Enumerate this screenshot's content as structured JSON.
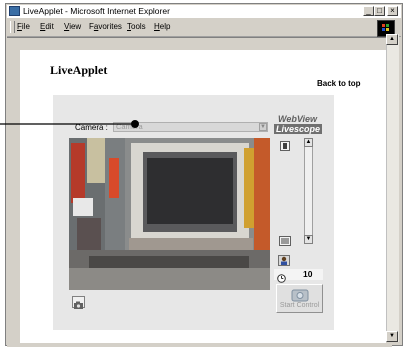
{
  "window": {
    "title": "LiveApplet - Microsoft Internet Explorer",
    "minimize": "_",
    "maximize": "□",
    "close": "×"
  },
  "menubar": {
    "items": [
      {
        "u": "F",
        "rest": "ile"
      },
      {
        "u": "E",
        "rest": "dit"
      },
      {
        "u": "V",
        "rest": "iew"
      },
      {
        "pre": "F",
        "u": "a",
        "rest": "vorites"
      },
      {
        "u": "T",
        "rest": "ools"
      },
      {
        "u": "H",
        "rest": "elp"
      }
    ]
  },
  "page": {
    "heading": "LiveApplet",
    "back_to_top": "Back to top"
  },
  "viewer": {
    "camera_label": "Camera :",
    "camera_value": "Camera",
    "logo_line1": "WebView",
    "logo_line2": "Livescope",
    "timer_value": "10",
    "start_control": "Start Control"
  },
  "colors": {
    "panel": "#e7e7e7",
    "window": "#d4d0c8"
  }
}
